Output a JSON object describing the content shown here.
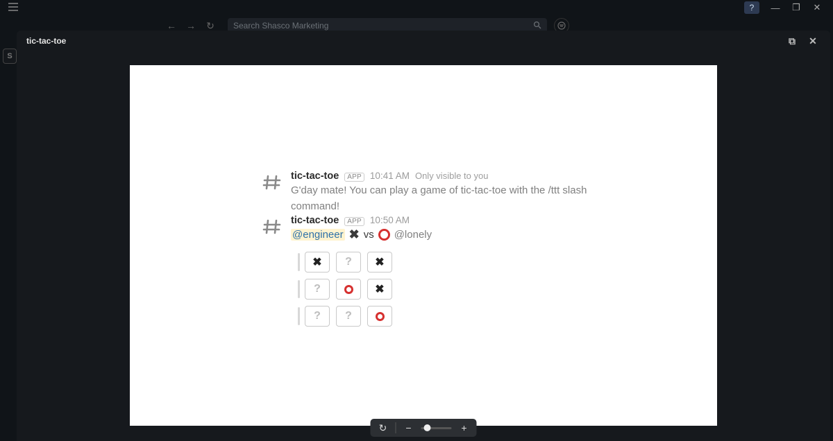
{
  "window": {
    "help_glyph": "?",
    "minimize": "—",
    "maximize": "❐",
    "close": "✕"
  },
  "nav": {
    "back": "←",
    "forward": "→",
    "history": "↻",
    "search_placeholder": "Search Shasco Marketing",
    "search_icon": "🔍",
    "filter": "⊘"
  },
  "left_rail": {
    "label": "S"
  },
  "overlay": {
    "title": "tic-tac-toe",
    "open_icon": "⧉",
    "close_icon": "✕"
  },
  "messages": [
    {
      "sender": "tic-tac-toe",
      "badge": "APP",
      "time": "10:41 AM",
      "visibility": "Only visible to you",
      "text": "G'day mate! You can play a game of tic-tac-toe with the /ttt slash command!"
    },
    {
      "sender": "tic-tac-toe",
      "badge": "APP",
      "time": "10:50 AM",
      "players": {
        "p1_mention": "@engineer",
        "vs": "vs",
        "p2_mention": "@lonely"
      }
    }
  ],
  "board": {
    "rows": [
      [
        "X",
        "?",
        "X"
      ],
      [
        "?",
        "O",
        "X"
      ],
      [
        "?",
        "?",
        "O"
      ]
    ]
  },
  "zoom": {
    "reset": "↻",
    "minus": "−",
    "plus": "+"
  }
}
